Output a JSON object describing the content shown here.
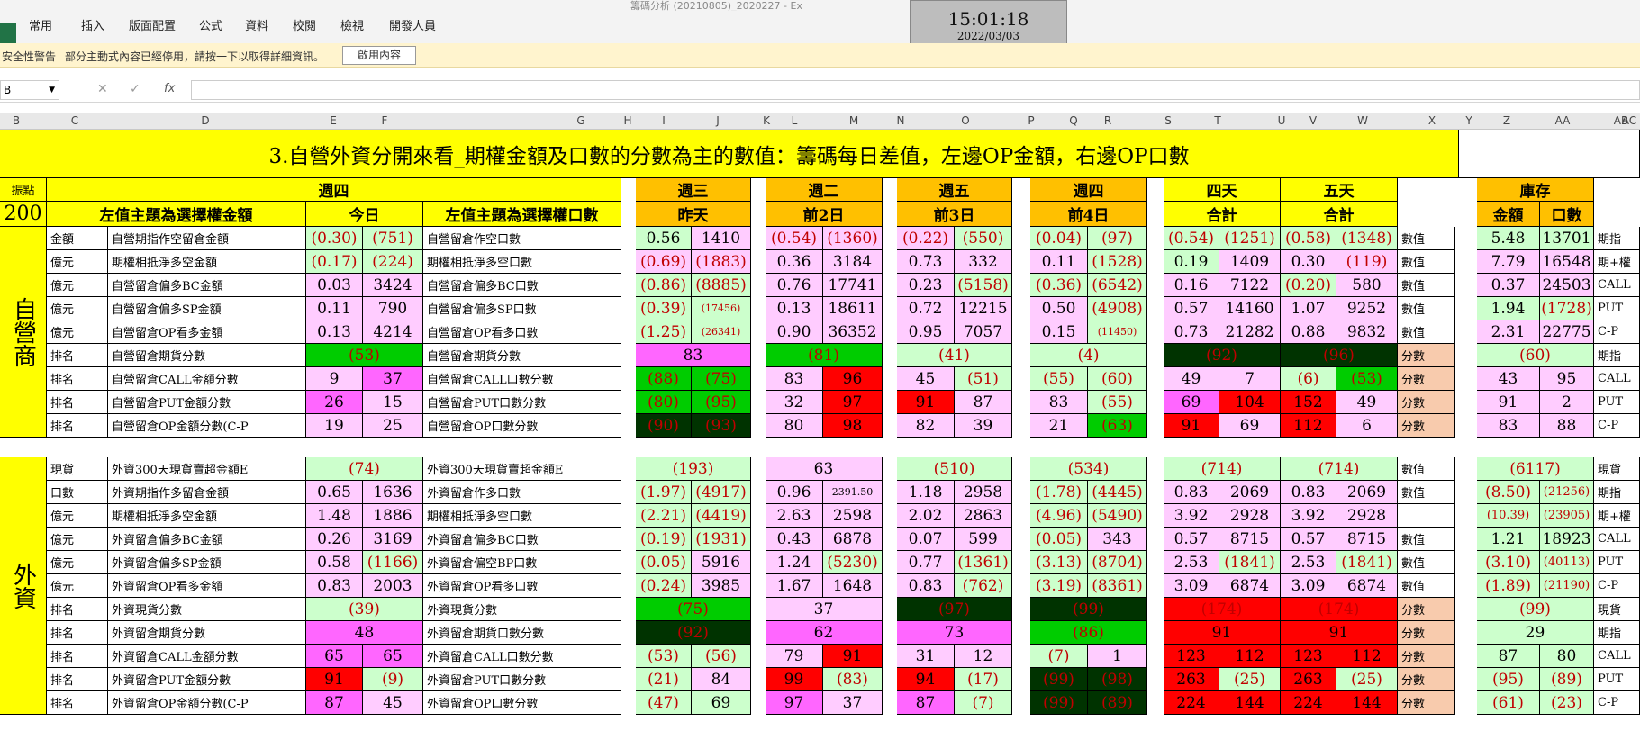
{
  "window": {
    "title": "籌碼分析 (20210805)_2020227 - Ex",
    "clock_time": "15:01:18",
    "clock_date": "2022/03/03"
  },
  "ribbon": {
    "tabs": [
      "常用",
      "插入",
      "版面配置",
      "公式",
      "資料",
      "校閱",
      "檢視",
      "開發人員"
    ]
  },
  "security": {
    "title": "安全性警告",
    "message": "部分主動式內容已經停用，請按一下以取得詳細資訊。",
    "button": "啟用內容"
  },
  "formula_bar": {
    "name_box": "B",
    "fx": "fx"
  },
  "columns": [
    "B",
    "C",
    "D",
    "E",
    "F",
    "G",
    "H",
    "I",
    "J",
    "K",
    "L",
    "M",
    "N",
    "O",
    "P",
    "Q",
    "R",
    "S",
    "T",
    "U",
    "V",
    "W",
    "X",
    "Y",
    "Z",
    "AA",
    "AB",
    "AC"
  ],
  "sheet": {
    "title": "3.自營外資分開來看_期權金額及口數的分數為主的數值：籌碼每日差值，左邊OP金額，右邊OP口數",
    "corner": "振點",
    "corner_value": "200",
    "headers": {
      "thu": "週四",
      "wed": "週三",
      "tue": "週二",
      "fri": "週五",
      "thu2": "週四",
      "four": "四天",
      "five": "五天",
      "inv": "庫存",
      "left_topic": "左值主題為選擇權金額",
      "today": "今日",
      "right_topic": "左值主題為選擇權口數",
      "yesterday": "昨天",
      "d2": "前2日",
      "d3": "前3日",
      "d4": "前4日",
      "total": "合計",
      "total2": "合計",
      "amount": "金額",
      "contracts": "口數"
    },
    "dealer_label": "自營商",
    "foreign_label": "外資",
    "dealer_rows": [
      [
        "金額",
        "自營期指作空留倉金額",
        "(0.30)",
        "(751)",
        "自營留倉作空口數",
        "0.56",
        "1410",
        "(0.54)",
        "(1360)",
        "(0.22)",
        "(550)",
        "(0.04)",
        "(97)",
        "(0.54)",
        "(1251)",
        "(0.58)",
        "(1348)",
        "數值",
        "5.48",
        "13701",
        "期指"
      ],
      [
        "億元",
        "期權相抵淨多空金額",
        "(0.17)",
        "(224)",
        "期權相抵淨多空口數",
        "(0.69)",
        "(1883)",
        "0.36",
        "3184",
        "0.73",
        "332",
        "0.11",
        "(1528)",
        "0.19",
        "1409",
        "0.30",
        "(119)",
        "數值",
        "7.79",
        "16548",
        "期+權"
      ],
      [
        "億元",
        "自營留倉偏多BC金額",
        "0.03",
        "3424",
        "自營留倉偏多BC口數",
        "(0.86)",
        "(8885)",
        "0.76",
        "17741",
        "0.23",
        "(5158)",
        "(0.36)",
        "(6542)",
        "0.16",
        "7122",
        "(0.20)",
        "580",
        "數值",
        "0.37",
        "24503",
        "CALL"
      ],
      [
        "億元",
        "自營留倉偏多SP金額",
        "0.11",
        "790",
        "自營留倉偏多SP口數",
        "(0.39)",
        "(17456)",
        "0.13",
        "18611",
        "0.72",
        "12215",
        "0.50",
        "(4908)",
        "0.57",
        "14160",
        "1.07",
        "9252",
        "數值",
        "1.94",
        "(1728)",
        "PUT"
      ],
      [
        "億元",
        "自營留倉OP看多金額",
        "0.13",
        "4214",
        "自營留倉OP看多口數",
        "(1.25)",
        "(26341)",
        "0.90",
        "36352",
        "0.95",
        "7057",
        "0.15",
        "(11450)",
        "0.73",
        "21282",
        "0.88",
        "9832",
        "數值",
        "2.31",
        "22775",
        "C-P"
      ],
      [
        "排名",
        "自營留倉期貨分數",
        "(53)",
        "",
        "自營留倉期貨分數",
        "83",
        "",
        "(81)",
        "",
        "(41)",
        "",
        "(4)",
        "",
        "(92)",
        "",
        "(96)",
        "",
        "分數",
        "(60)",
        "",
        "期指"
      ],
      [
        "排名",
        "自營留倉CALL金額分數",
        "9",
        "37",
        "自營留倉CALL口數分數",
        "(88)",
        "(75)",
        "83",
        "96",
        "45",
        "(51)",
        "(55)",
        "(60)",
        "49",
        "7",
        "(6)",
        "(53)",
        "分數",
        "43",
        "95",
        "CALL"
      ],
      [
        "排名",
        "自營留倉PUT金額分數",
        "26",
        "15",
        "自營留倉PUT口數分數",
        "(80)",
        "(95)",
        "32",
        "97",
        "91",
        "87",
        "83",
        "(55)",
        "69",
        "104",
        "152",
        "49",
        "分數",
        "91",
        "2",
        "PUT"
      ],
      [
        "排名",
        "自營留倉OP金額分數(C-P",
        "19",
        "25",
        "自營留倉OP口數分數",
        "(90)",
        "(93)",
        "80",
        "98",
        "82",
        "39",
        "21",
        "(63)",
        "91",
        "69",
        "112",
        "6",
        "分數",
        "83",
        "88",
        "C-P"
      ]
    ],
    "foreign_rows": [
      [
        "現貨",
        "外資300天現貨賣超金額E",
        "(74)",
        "",
        "外資300天現貨賣超金額E",
        "(193)",
        "",
        "63",
        "",
        "(510)",
        "",
        "(534)",
        "",
        "(714)",
        "",
        "(714)",
        "",
        "數值",
        "(6117)",
        "",
        "現貨"
      ],
      [
        "口數",
        "外資期指作多留倉金額",
        "0.65",
        "1636",
        "外資留倉作多口數",
        "(1.97)",
        "(4917)",
        "0.96",
        "2391.50",
        "1.18",
        "2958",
        "(1.78)",
        "(4445)",
        "0.83",
        "2069",
        "0.83",
        "2069",
        "數值",
        "(8.50)",
        "(21256)",
        "期指"
      ],
      [
        "億元",
        "期權相抵淨多空金額",
        "1.48",
        "1886",
        "期權相抵淨多空口數",
        "(2.21)",
        "(4419)",
        "2.63",
        "2598",
        "2.02",
        "2863",
        "(4.96)",
        "(5490)",
        "3.92",
        "2928",
        "3.92",
        "2928",
        "",
        "(10.39)",
        "(23905)",
        "期+權"
      ],
      [
        "億元",
        "外資留倉偏多BC金額",
        "0.26",
        "3169",
        "外資留倉偏多BC口數",
        "(0.19)",
        "(1931)",
        "0.43",
        "6878",
        "0.07",
        "599",
        "(0.05)",
        "343",
        "0.57",
        "8715",
        "0.57",
        "8715",
        "數值",
        "1.21",
        "18923",
        "CALL"
      ],
      [
        "億元",
        "外資留倉偏多SP金額",
        "0.58",
        "(1166)",
        "外資留倉偏空BP口數",
        "(0.05)",
        "5916",
        "1.24",
        "(5230)",
        "0.77",
        "(1361)",
        "(3.13)",
        "(8704)",
        "2.53",
        "(1841)",
        "2.53",
        "(1841)",
        "數值",
        "(3.10)",
        "(40113)",
        "PUT"
      ],
      [
        "億元",
        "外資留倉OP看多金額",
        "0.83",
        "2003",
        "外資留倉OP看多口數",
        "(0.24)",
        "3985",
        "1.67",
        "1648",
        "0.83",
        "(762)",
        "(3.19)",
        "(8361)",
        "3.09",
        "6874",
        "3.09",
        "6874",
        "數值",
        "(1.89)",
        "(21190)",
        "C-P"
      ],
      [
        "排名",
        "外資現貨分數",
        "(39)",
        "",
        "外資現貨分數",
        "(75)",
        "",
        "37",
        "",
        "(97)",
        "",
        "(99)",
        "",
        "(174)",
        "",
        "(174)",
        "",
        "分數",
        "(99)",
        "",
        "現貨"
      ],
      [
        "排名",
        "外資留倉期貨分數",
        "48",
        "",
        "外資留倉期貨口數分數",
        "(92)",
        "",
        "62",
        "",
        "73",
        "",
        "(86)",
        "",
        "91",
        "",
        "91",
        "",
        "分數",
        "29",
        "",
        "期指"
      ],
      [
        "排名",
        "外資留倉CALL金額分數",
        "65",
        "65",
        "外資留倉CALL口數分數",
        "(53)",
        "(56)",
        "79",
        "91",
        "31",
        "12",
        "(7)",
        "1",
        "123",
        "112",
        "123",
        "112",
        "分數",
        "87",
        "80",
        "CALL"
      ],
      [
        "排名",
        "外資留倉PUT金額分數",
        "91",
        "(9)",
        "外資留倉PUT口數分數",
        "(21)",
        "84",
        "99",
        "(83)",
        "94",
        "(17)",
        "(99)",
        "(98)",
        "263",
        "(25)",
        "263",
        "(25)",
        "分數",
        "(95)",
        "(89)",
        "PUT"
      ],
      [
        "排名",
        "外資留倉OP金額分數(C-P",
        "87",
        "45",
        "外資留倉OP口數分數",
        "(47)",
        "69",
        "97",
        "37",
        "87",
        "(7)",
        "(99)",
        "(89)",
        "224",
        "144",
        "224",
        "144",
        "分數",
        "(61)",
        "(23)",
        "C-P"
      ]
    ],
    "colors": {
      "yellow": "#ffff00",
      "orange": "#ffc000",
      "light_green": "#ccffcc",
      "green": "#00cc00",
      "dark_green": "#003300",
      "pink": "#ffccff",
      "magenta": "#ff66ff",
      "red": "#ff0000",
      "peach": "#f8cbad"
    }
  }
}
